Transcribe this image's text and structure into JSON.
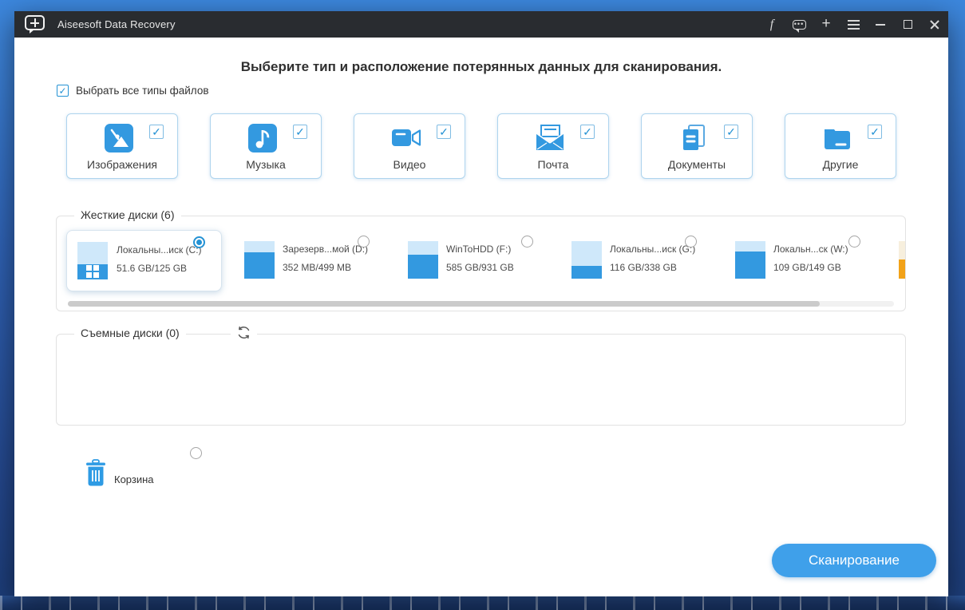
{
  "titlebar": {
    "title": "Aiseesoft Data Recovery"
  },
  "main": {
    "heading": "Выберите тип и расположение потерянных данных для сканирования.",
    "select_all_label": "Выбрать все типы файлов",
    "select_all_checked": true
  },
  "file_types": [
    {
      "label": "Изображения",
      "icon": "image-icon",
      "checked": true
    },
    {
      "label": "Музыка",
      "icon": "music-icon",
      "checked": true
    },
    {
      "label": "Видео",
      "icon": "video-icon",
      "checked": true
    },
    {
      "label": "Почта",
      "icon": "mail-icon",
      "checked": true
    },
    {
      "label": "Документы",
      "icon": "documents-icon",
      "checked": true
    },
    {
      "label": "Другие",
      "icon": "folder-icon",
      "checked": true
    }
  ],
  "hard_disks": {
    "legend": "Жесткие диски (6)",
    "disks": [
      {
        "name": "Локальны...иск (C:)",
        "size": "51.6 GB/125 GB",
        "selected": true,
        "fill_style": "height:41%"
      },
      {
        "name": "Зарезерв...мой (D:)",
        "size": "352 MB/499 MB",
        "selected": false,
        "fill_style": "height:70%"
      },
      {
        "name": "WinToHDD (F:)",
        "size": "585 GB/931 GB",
        "selected": false,
        "fill_style": "height:63%"
      },
      {
        "name": "Локальны...иск (G:)",
        "size": "116 GB/338 GB",
        "selected": false,
        "fill_style": "height:34%"
      },
      {
        "name": "Локальн...ск (W:)",
        "size": "109 GB/149 GB",
        "selected": false,
        "fill_style": "height:73%"
      },
      {
        "name": "",
        "size": "",
        "selected": false,
        "fill_style": "height:52%",
        "partially_visible": true,
        "color": "orange"
      }
    ]
  },
  "removable_disks": {
    "legend": "Съемные диски (0)"
  },
  "recycle_bin": {
    "label": "Корзина",
    "selected": false
  },
  "actions": {
    "scan_label": "Сканирование"
  },
  "colors": {
    "accent_blue": "#3399e0",
    "titlebar_bg": "#292c30",
    "button_blue": "#3fa0ea",
    "orange_disk": "#f2a218"
  }
}
